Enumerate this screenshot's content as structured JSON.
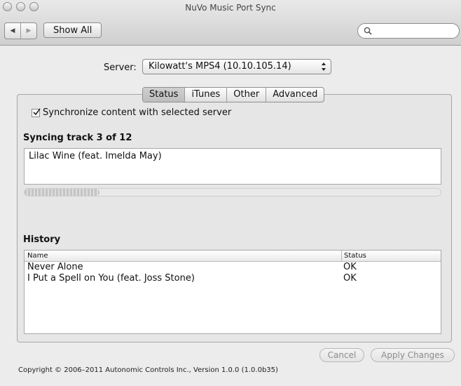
{
  "window": {
    "title": "NuVo Music Port Sync"
  },
  "toolbar": {
    "back_icon": "left-triangle-icon",
    "forward_icon": "right-triangle-icon",
    "show_all_label": "Show All",
    "search_value": "",
    "search_placeholder": ""
  },
  "server": {
    "label": "Server:",
    "selected": "Kilowatt's MPS4 (10.10.105.14)"
  },
  "tabs": [
    {
      "label": "Status",
      "active": true
    },
    {
      "label": "iTunes",
      "active": false
    },
    {
      "label": "Other",
      "active": false
    },
    {
      "label": "Advanced",
      "active": false
    }
  ],
  "status": {
    "sync_checkbox_label": "Synchronize content with selected server",
    "sync_checked": true,
    "syncing_title": "Syncing track 3 of 12",
    "current_track": "Lilac Wine (feat. Imelda May)",
    "progress_fraction": 0.18
  },
  "history": {
    "title": "History",
    "columns": [
      "Name",
      "Status"
    ],
    "rows": [
      {
        "name": "Never Alone",
        "status": "OK"
      },
      {
        "name": "I Put a Spell on You (feat. Joss Stone)",
        "status": "OK"
      }
    ]
  },
  "buttons": {
    "cancel_label": "Cancel",
    "apply_label": "Apply Changes"
  },
  "footer": {
    "copyright": "Copyright © 2006–2011 Autonomic Controls Inc., Version 1.0.0 (1.0.0b35)"
  }
}
